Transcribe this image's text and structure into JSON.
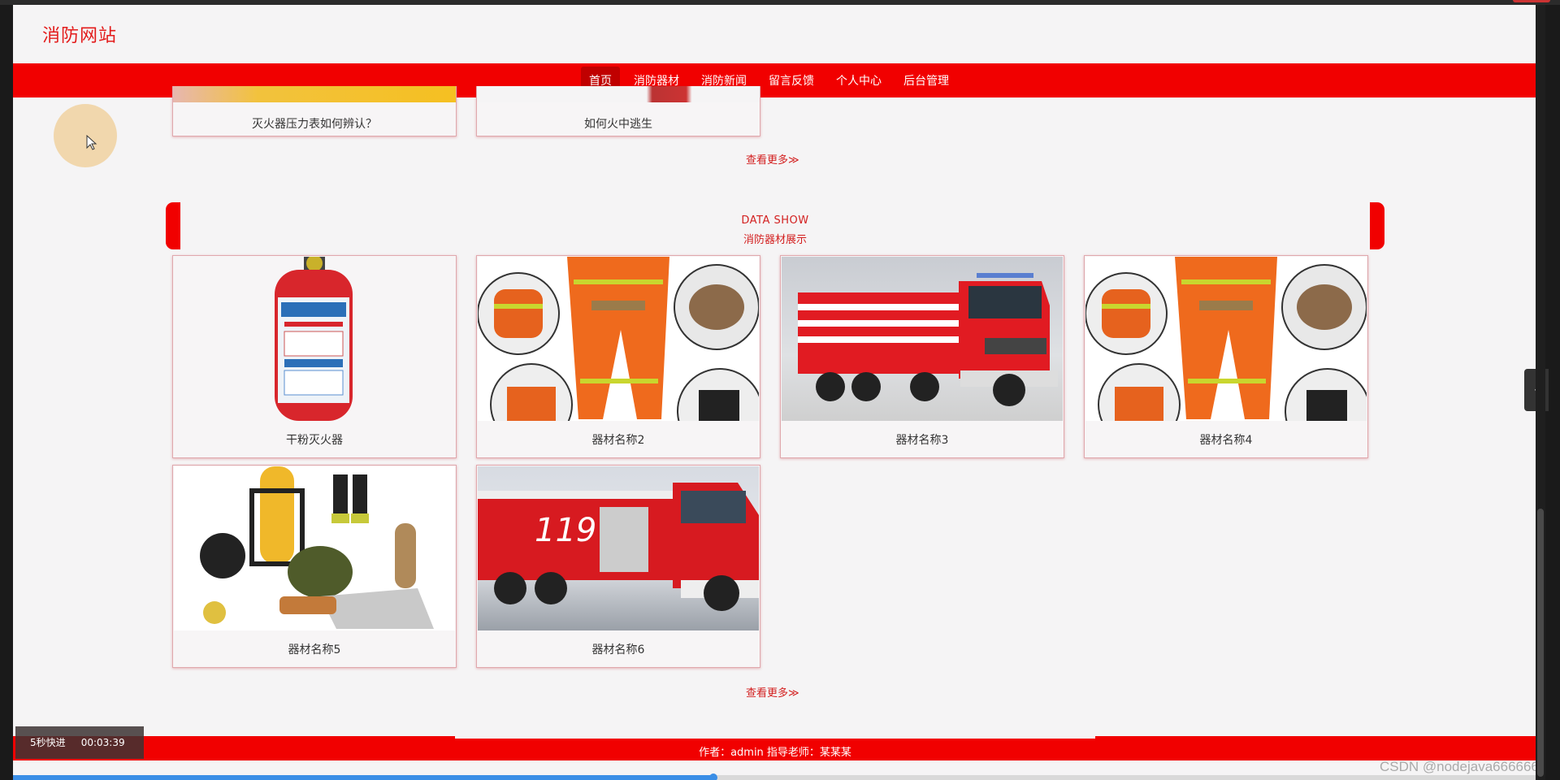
{
  "site": {
    "logo": "消防网站"
  },
  "nav": {
    "items": [
      {
        "label": "首页",
        "active": true
      },
      {
        "label": "消防器材"
      },
      {
        "label": "消防新闻"
      },
      {
        "label": "留言反馈"
      },
      {
        "label": "个人中心"
      },
      {
        "label": "后台管理"
      }
    ]
  },
  "news": {
    "items": [
      {
        "title": "灭火器压力表如何辨认？"
      },
      {
        "title": "如何火中逃生"
      }
    ],
    "more": "查看更多≫"
  },
  "equipment_section": {
    "en_title": "DATA SHOW",
    "cn_title": "消防器材展示",
    "items": [
      {
        "name": "干粉灭火器",
        "image": "fire-extinguisher"
      },
      {
        "name": "器材名称2",
        "image": "firefighter-suit"
      },
      {
        "name": "器材名称3",
        "image": "fire-truck"
      },
      {
        "name": "器材名称4",
        "image": "firefighter-suit"
      },
      {
        "name": "器材名称5",
        "image": "breathing-apparatus-kit"
      },
      {
        "name": "器材名称6",
        "image": "fire-engine-119"
      }
    ],
    "more": "查看更多≫"
  },
  "footer": {
    "text": "作者：admin 指导老师：某某某"
  },
  "player": {
    "label": "5秒快进",
    "time": "00:03:39",
    "progress": 0.46
  },
  "side_tab": {
    "icon": "‹"
  },
  "watermark": "CSDN @nodejava666666",
  "colors": {
    "brand_red": "#f10000",
    "text_red": "#d32020",
    "page_bg": "#f5f4f5"
  }
}
